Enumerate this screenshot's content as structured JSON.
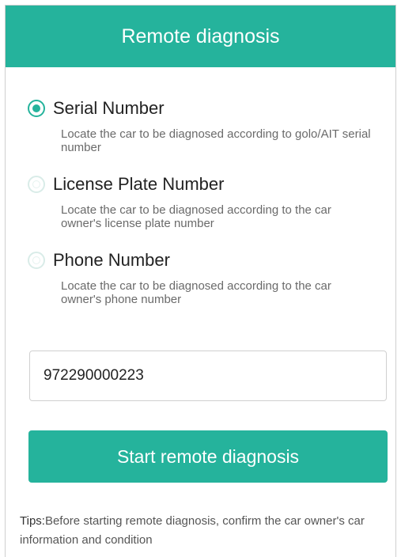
{
  "header": {
    "title": "Remote diagnosis"
  },
  "options": [
    {
      "label": "Serial Number",
      "description": "Locate the car to be diagnosed according to golo/AIT serial number",
      "selected": true
    },
    {
      "label": "License Plate Number",
      "description": "Locate the car to be diagnosed according to the car owner's license plate number",
      "selected": false
    },
    {
      "label": "Phone Number",
      "description": "Locate the car to be diagnosed according to the car owner's phone number",
      "selected": false
    }
  ],
  "input": {
    "value": "972290000223"
  },
  "start_button": {
    "label": "Start remote diagnosis"
  },
  "tips": {
    "label": "Tips:",
    "text": "Before starting remote diagnosis, confirm the car owner's car information and condition"
  },
  "colors": {
    "accent": "#25b39c",
    "text": "#222222",
    "muted": "#6a6a6a"
  }
}
